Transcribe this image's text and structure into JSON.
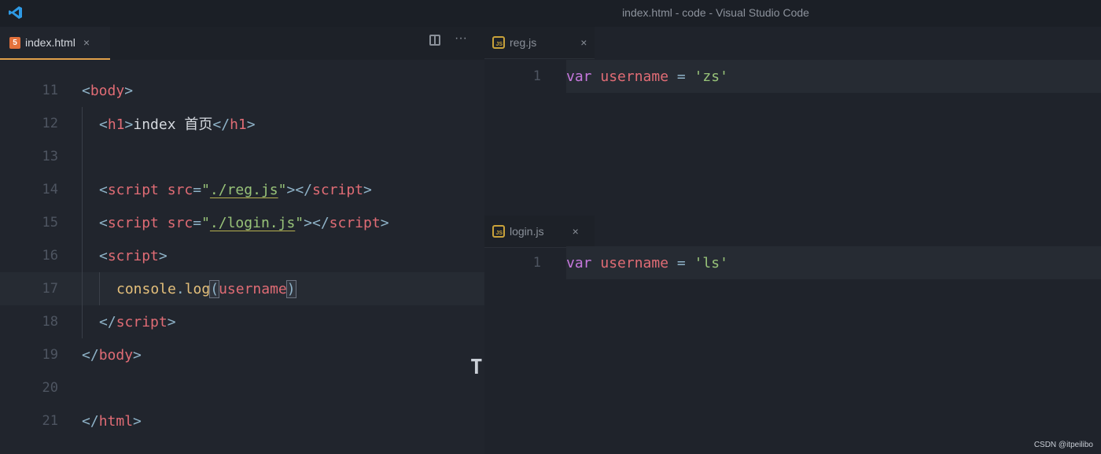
{
  "window": {
    "title": "index.html - code - Visual Studio Code"
  },
  "left_editor": {
    "tab": {
      "filename": "index.html",
      "icon": "html5-icon",
      "close": "×"
    },
    "actions": {
      "split": "split-editor-icon",
      "more": "···"
    },
    "lines": [
      {
        "n": "11"
      },
      {
        "n": "12"
      },
      {
        "n": "13"
      },
      {
        "n": "14"
      },
      {
        "n": "15"
      },
      {
        "n": "16"
      },
      {
        "n": "17"
      },
      {
        "n": "18"
      },
      {
        "n": "19"
      },
      {
        "n": "20"
      },
      {
        "n": "21"
      }
    ],
    "code": {
      "l11": {
        "open": "<",
        "tag": "body",
        "close": ">"
      },
      "l12": {
        "open": "<",
        "tag": "h1",
        "close": ">",
        "text": "index 首页",
        "open2": "</",
        "tag2": "h1",
        "close2": ">"
      },
      "l14": {
        "open": "<",
        "tag": "script",
        "attr": "src",
        "eq": "=",
        "q1": "\"",
        "val": "./reg.js",
        "q2": "\"",
        "close": ">",
        "open2": "</",
        "tag2": "script",
        "close2": ">"
      },
      "l15": {
        "open": "<",
        "tag": "script",
        "attr": "src",
        "eq": "=",
        "q1": "\"",
        "val": "./login.js",
        "q2": "\"",
        "close": ">",
        "open2": "</",
        "tag2": "script",
        "close2": ">"
      },
      "l16": {
        "open": "<",
        "tag": "script",
        "close": ">"
      },
      "l17": {
        "obj": "console",
        "dot": ".",
        "fn": "log",
        "lp": "(",
        "arg": "username",
        "rp": ")"
      },
      "l18": {
        "open": "</",
        "tag": "script",
        "close": ">"
      },
      "l19": {
        "open": "</",
        "tag": "body",
        "close": ">"
      },
      "l21": {
        "open": "</",
        "tag": "html",
        "close": ">"
      }
    }
  },
  "right_top": {
    "tab": {
      "filename": "reg.js",
      "close": "×"
    },
    "line": {
      "n": "1",
      "kw": "var",
      "name": "username",
      "op": "=",
      "value": "'zs'"
    }
  },
  "right_bottom": {
    "tab": {
      "filename": "login.js",
      "close": "×"
    },
    "line": {
      "n": "1",
      "kw": "var",
      "name": "username",
      "op": "=",
      "value": "'ls'"
    }
  },
  "watermark": "CSDN @itpeilibo",
  "cursor_glyph": "T",
  "colors": {
    "tag": "#e06c75",
    "string": "#98c379",
    "keyword": "#c678dd",
    "function": "#e5c07b",
    "accent": "#e0a04a"
  }
}
